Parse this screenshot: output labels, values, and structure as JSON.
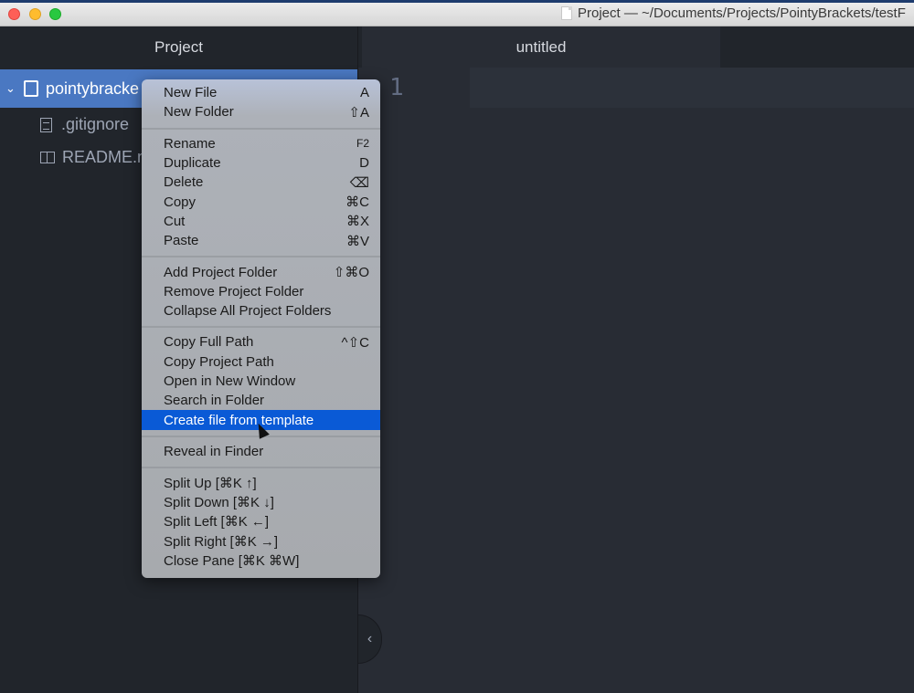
{
  "window": {
    "title": "Project — ~/Documents/Projects/PointyBrackets/testF"
  },
  "sidebar": {
    "header": "Project",
    "root": {
      "label": "pointybracke",
      "icon": "repo-book-icon",
      "expanded": true
    },
    "items": [
      {
        "label": ".gitignore",
        "icon": "file-text-icon"
      },
      {
        "label": "README.m",
        "icon": "book-open-icon"
      }
    ]
  },
  "editor": {
    "tab": "untitled",
    "line_number": "1",
    "collapse_icon": "chevron-left-icon"
  },
  "context_menu": {
    "groups": [
      [
        {
          "label": "New File",
          "shortcut": "A"
        },
        {
          "label": "New Folder",
          "shortcut": "⇧A"
        }
      ],
      [
        {
          "label": "Rename",
          "shortcut": "F2"
        },
        {
          "label": "Duplicate",
          "shortcut": "D"
        },
        {
          "label": "Delete",
          "shortcut": "⌫"
        },
        {
          "label": "Copy",
          "shortcut": "⌘C"
        },
        {
          "label": "Cut",
          "shortcut": "⌘X"
        },
        {
          "label": "Paste",
          "shortcut": "⌘V"
        }
      ],
      [
        {
          "label": "Add Project Folder",
          "shortcut": "⇧⌘O"
        },
        {
          "label": "Remove Project Folder",
          "shortcut": ""
        },
        {
          "label": "Collapse All Project Folders",
          "shortcut": ""
        }
      ],
      [
        {
          "label": "Copy Full Path",
          "shortcut": "^⇧C"
        },
        {
          "label": "Copy Project Path",
          "shortcut": ""
        },
        {
          "label": "Open in New Window",
          "shortcut": ""
        },
        {
          "label": "Search in Folder",
          "shortcut": ""
        },
        {
          "label": "Create file from template",
          "shortcut": "",
          "active": true
        }
      ],
      [
        {
          "label": "Reveal in Finder",
          "shortcut": ""
        }
      ],
      [
        {
          "label": "Split Up [⌘K ↑]",
          "shortcut": ""
        },
        {
          "label": "Split Down [⌘K ↓]",
          "shortcut": ""
        },
        {
          "label": "Split Left [⌘K ←]",
          "shortcut": ""
        },
        {
          "label": "Split Right [⌘K →]",
          "shortcut": ""
        },
        {
          "label": "Close Pane [⌘K ⌘W]",
          "shortcut": ""
        }
      ]
    ],
    "highlight_color": "#0a5ad6"
  }
}
